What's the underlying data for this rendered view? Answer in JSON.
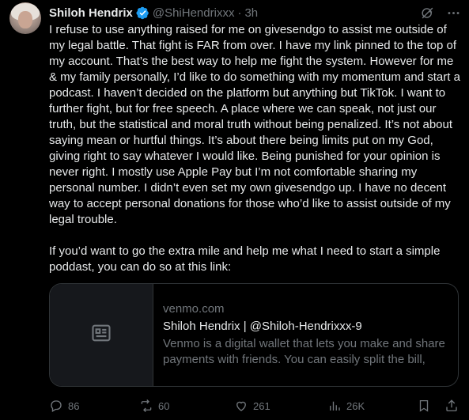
{
  "tweet": {
    "author_name": "Shiloh Hendrix",
    "handle": "@ShiHendrixxx",
    "separator": "·",
    "time": "3h",
    "paragraphs": [
      "I refuse to use anything raised for me on givesendgo to assist me outside of my legal battle. That fight is FAR from over. I have my link pinned to the top of my account. That’s the best way to help me fight the system. However for me & my family personally, I’d like to do something with my momentum and start a podcast. I haven’t decided on the platform but anything but TikTok. I want to further fight, but for free speech. A place where we can speak, not just our truth, but the statistical and moral truth without being penalized. It’s not about saying mean or hurtful things. It’s about there being limits put on my God, giving right to say whatever I would like. Being punished for your opinion is never right. I mostly use Apple Pay but I’m not comfortable sharing my personal number. I didn’t even set my own givesendgo up. I have no decent way to accept personal donations for those who’d like to assist outside of my legal trouble.",
      "If you’d want to go the extra mile and help me what I need to start a simple poddast, you can do so at this link:"
    ]
  },
  "link_card": {
    "domain": "venmo.com",
    "title": "Shiloh Hendrix | @Shiloh-Hendrixxx-9",
    "description": "Venmo is a digital wallet that lets you make and share payments with friends. You can easily split the bill, ca..."
  },
  "actions": {
    "replies": "86",
    "reposts": "60",
    "likes": "261",
    "views": "26K"
  },
  "colors": {
    "background": "#000000",
    "text": "#e7e9ea",
    "muted": "#71767b",
    "verified": "#1d9bf0",
    "border": "#2f3336"
  },
  "icons": {
    "verified": "verified-badge-icon",
    "grok": "grok-icon",
    "more": "more-options-icon",
    "card": "article-icon",
    "reply": "reply-icon",
    "repost": "repost-icon",
    "like": "like-icon",
    "views": "views-icon",
    "bookmark": "bookmark-icon",
    "share": "share-icon"
  }
}
